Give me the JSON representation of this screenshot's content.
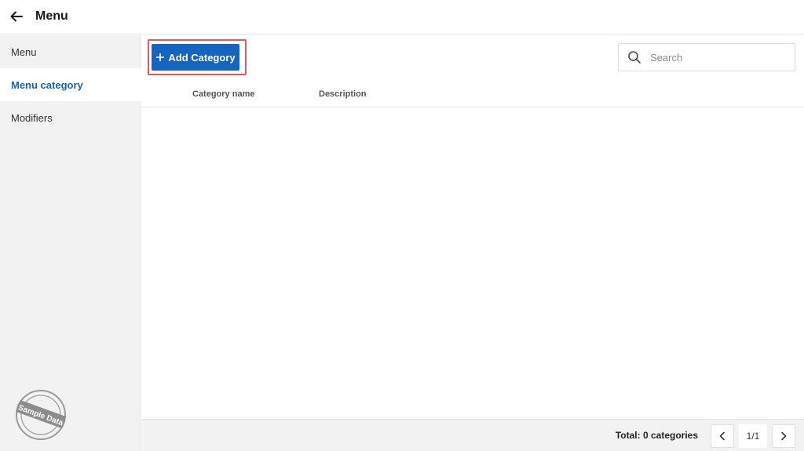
{
  "header": {
    "back_icon": "arrow-left-icon",
    "title": "Menu"
  },
  "sidebar": {
    "items": [
      {
        "label": "Menu",
        "active": false
      },
      {
        "label": "Menu category",
        "active": true
      },
      {
        "label": "Modifiers",
        "active": false
      }
    ],
    "stamp_text": "Sample Data"
  },
  "toolbar": {
    "add_icon": "plus-icon",
    "add_label": "Add Category"
  },
  "search": {
    "icon": "search-icon",
    "placeholder": "Search",
    "value": ""
  },
  "table": {
    "columns": [
      "Category name",
      "Description"
    ],
    "rows": []
  },
  "footer": {
    "total_label": "Total: 0 categories",
    "page_indicator": "1/1",
    "prev_icon": "chevron-left-icon",
    "next_icon": "chevron-right-icon"
  },
  "colors": {
    "accent": "#1565c0",
    "highlight_border": "#e05a5a",
    "sidebar_bg": "#f2f2f2"
  }
}
